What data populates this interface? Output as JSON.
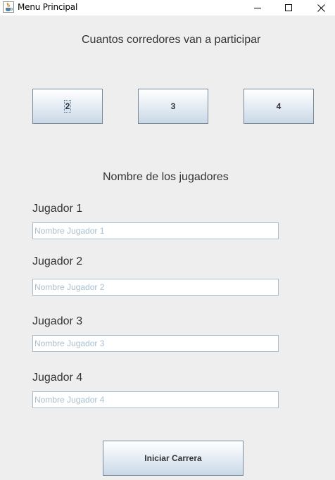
{
  "window": {
    "title": "Menu Principal",
    "icon": "java-cup-icon",
    "controls": [
      "minimize",
      "maximize",
      "close"
    ]
  },
  "runners": {
    "question": "Cuantos corredores van a participar",
    "options": [
      "2",
      "3",
      "4"
    ]
  },
  "players": {
    "heading": "Nombre de los jugadores",
    "items": [
      {
        "label": "Jugador 1",
        "value": "",
        "placeholder": "Nombre Jugador 1"
      },
      {
        "label": "Jugador 2",
        "value": "",
        "placeholder": "Nombre Jugador 2"
      },
      {
        "label": "Jugador 3",
        "value": "",
        "placeholder": "Nombre Jugador 3"
      },
      {
        "label": "Jugador 4",
        "value": "",
        "placeholder": "Nombre Jugador 4"
      }
    ]
  },
  "actions": {
    "start_label": "Iniciar Carrera"
  }
}
